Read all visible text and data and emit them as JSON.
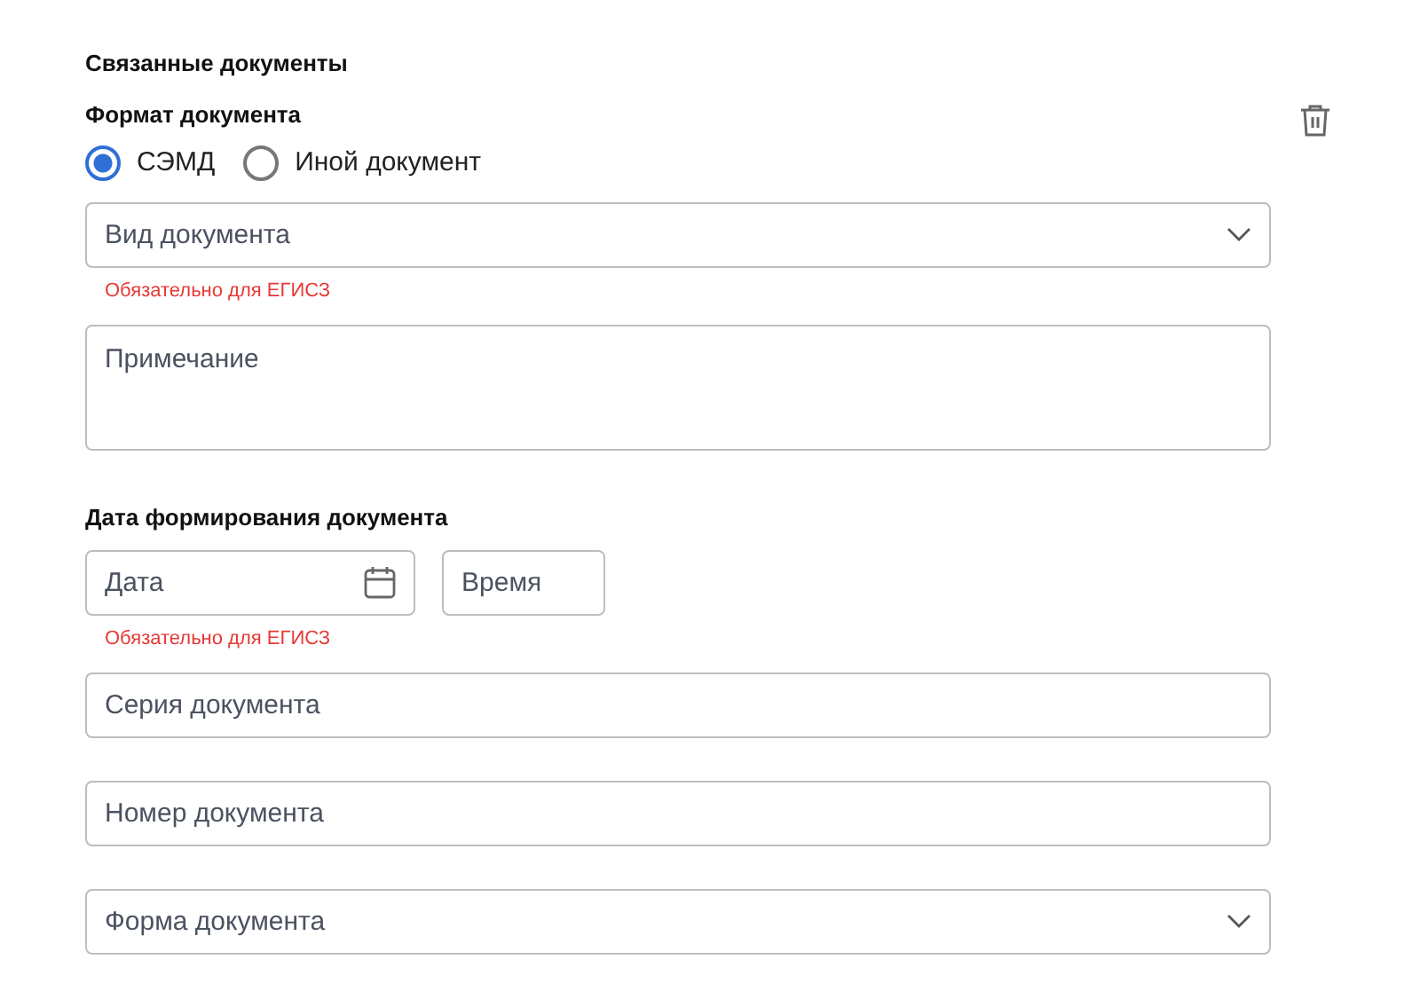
{
  "section_title": "Связанные документы",
  "format": {
    "label": "Формат документа",
    "options": [
      {
        "label": "СЭМД",
        "selected": true
      },
      {
        "label": "Иной документ",
        "selected": false
      }
    ]
  },
  "fields": [
    {
      "kind": "select",
      "placeholder": "Вид документа",
      "error": "Обязательно для ЕГИСЗ"
    },
    {
      "kind": "textarea",
      "placeholder": "Примечание"
    },
    {
      "kind": "datetime",
      "label": "Дата формирования документа",
      "date_placeholder": "Дата",
      "time_placeholder": "Время",
      "error": "Обязательно для ЕГИСЗ"
    },
    {
      "kind": "text",
      "placeholder": "Серия документа"
    },
    {
      "kind": "text",
      "placeholder": "Номер документа"
    },
    {
      "kind": "select",
      "placeholder": "Форма документа"
    }
  ]
}
